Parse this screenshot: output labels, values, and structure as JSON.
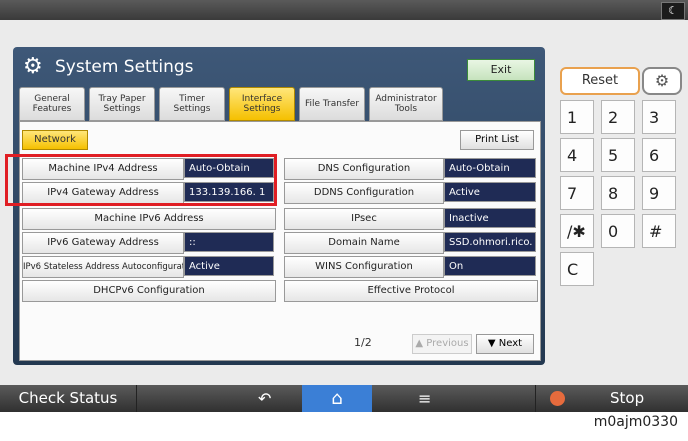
{
  "panel": {
    "title": "System Settings",
    "exit_label": "Exit",
    "tabs": [
      {
        "label": "General Features"
      },
      {
        "label": "Tray Paper Settings"
      },
      {
        "label": "Timer Settings"
      },
      {
        "label": "Interface Settings"
      },
      {
        "label": "File Transfer"
      },
      {
        "label": "Administrator Tools"
      }
    ],
    "subtab": "Network",
    "print_list": "Print List",
    "left_rows": [
      {
        "label": "Machine IPv4 Address",
        "value": "Auto-Obtain"
      },
      {
        "label": "IPv4 Gateway Address",
        "value": "133.139.166.  1"
      },
      {
        "label": "Machine IPv6 Address",
        "value": null
      },
      {
        "label": "IPv6 Gateway Address",
        "value": "::"
      },
      {
        "label": "IPv6 Stateless Address Autoconfiguration",
        "value": "Active"
      },
      {
        "label": "DHCPv6 Configuration",
        "value": null
      }
    ],
    "right_rows": [
      {
        "label": "DNS Configuration",
        "value": "Auto-Obtain"
      },
      {
        "label": "DDNS Configuration",
        "value": "Active"
      },
      {
        "label": "IPsec",
        "value": "Inactive"
      },
      {
        "label": "Domain Name",
        "value": "SSD.ohmori.rico."
      },
      {
        "label": "WINS Configuration",
        "value": "On"
      },
      {
        "label": "Effective Protocol",
        "value": null
      }
    ],
    "page_indicator": "1/2",
    "prev_label": "Previous",
    "next_label": "Next"
  },
  "keypad": {
    "reset_label": "Reset",
    "keys": [
      "1",
      "2",
      "3",
      "4",
      "5",
      "6",
      "7",
      "8",
      "9",
      "/✱",
      "0",
      "#",
      "C"
    ]
  },
  "bottom_bar": {
    "check_status": "Check Status",
    "stop_label": "Stop"
  },
  "caption": "m0ajm0330"
}
